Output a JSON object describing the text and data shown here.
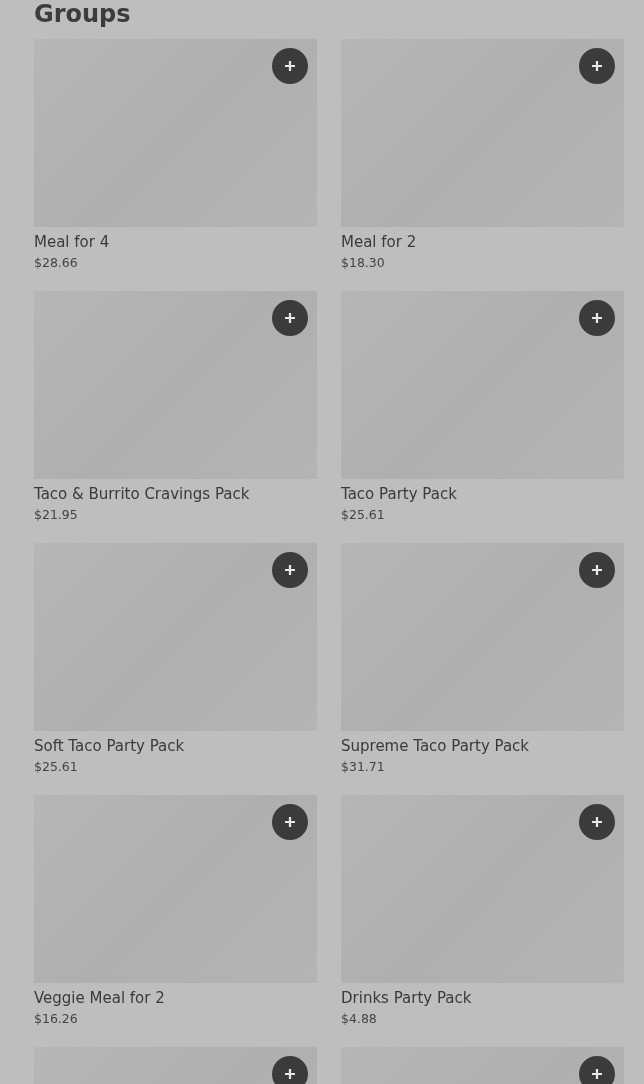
{
  "section": {
    "title": "Groups"
  },
  "items": [
    {
      "kind": "card",
      "name": "Meal for 4",
      "price": "$28.66"
    },
    {
      "kind": "card",
      "name": "Meal for 2",
      "price": "$18.30"
    },
    {
      "kind": "card",
      "name": "Taco & Burrito Cravings Pack",
      "price": "$21.95"
    },
    {
      "kind": "card",
      "name": "Taco Party Pack",
      "price": "$25.61"
    },
    {
      "kind": "card",
      "name": "Soft Taco Party Pack",
      "price": "$25.61"
    },
    {
      "kind": "card",
      "name": "Supreme Taco Party Pack",
      "price": "$31.71"
    },
    {
      "kind": "card",
      "name": "Veggie Meal for 2",
      "price": "$16.26"
    },
    {
      "kind": "card",
      "name": "Drinks Party Pack",
      "price": "$4.88"
    },
    {
      "kind": "cut"
    },
    {
      "kind": "cut"
    }
  ]
}
